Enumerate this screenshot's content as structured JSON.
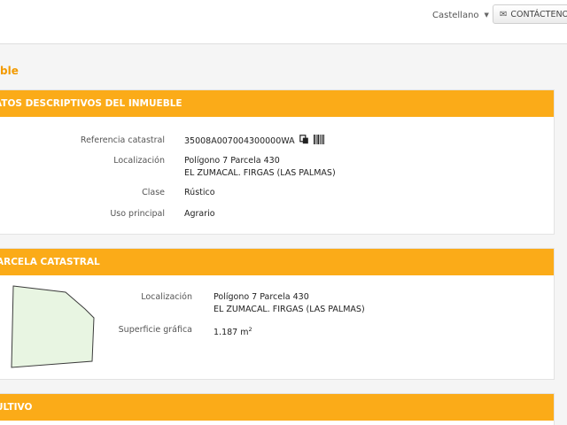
{
  "header": {
    "language": "Castellano",
    "contact_label": "CONTÁCTENO"
  },
  "page_title": "ble",
  "datos": {
    "title": "ATOS DESCRIPTIVOS DEL INMUEBLE",
    "ref_label": "Referencia catastral",
    "ref_value": "35008A007004300000WA",
    "loc_label": "Localización",
    "loc_line1": "Polígono 7 Parcela 430",
    "loc_line2": "EL ZUMACAL. FIRGAS (LAS PALMAS)",
    "clase_label": "Clase",
    "clase_value": "Rústico",
    "uso_label": "Uso principal",
    "uso_value": "Agrario"
  },
  "parcela": {
    "title": "ARCELA CATASTRAL",
    "loc_label": "Localización",
    "loc_line1": "Polígono 7 Parcela 430",
    "loc_line2": "EL ZUMACAL. FIRGAS (LAS PALMAS)",
    "sup_label": "Superficie gráfica",
    "sup_value": "1.187 m",
    "sup_unit_exp": "2"
  },
  "cultivo": {
    "title": "ULTIVO"
  },
  "colors": {
    "accent": "#fbab18",
    "title_orange": "#f29a00",
    "parcel_fill": "#e8f5e2"
  },
  "icons": [
    "chevron-down-icon",
    "envelope-icon",
    "copy-icon",
    "barcode-icon"
  ]
}
